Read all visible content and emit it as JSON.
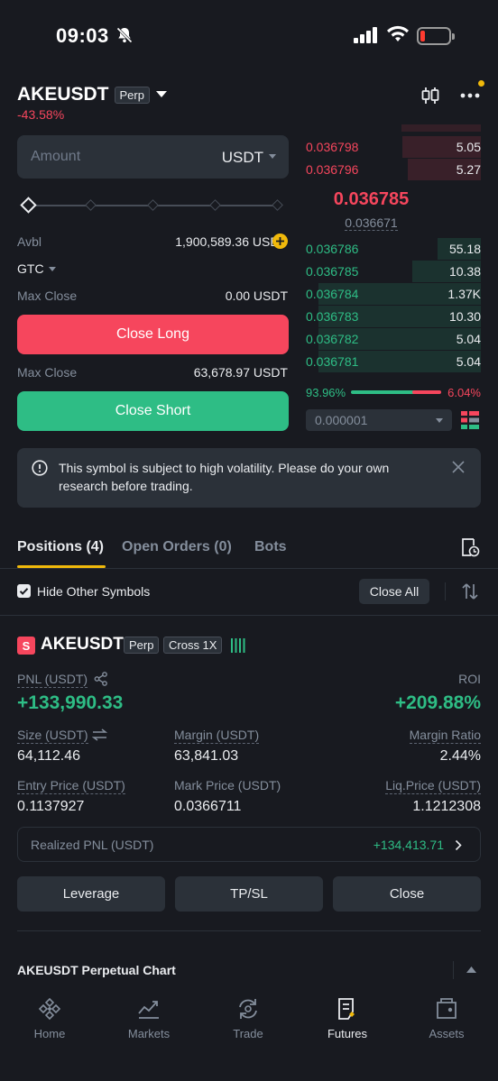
{
  "status_bar": {
    "time": "09:03"
  },
  "header": {
    "symbol": "AKEUSDT",
    "contract_type": "Perp",
    "change_pct": "-43.58%"
  },
  "order_form": {
    "amount_placeholder": "Amount",
    "amount_unit": "USDT",
    "avbl_label": "Avbl",
    "avbl_value": "1,900,589.36 USDT",
    "tif": "GTC",
    "max_close_label_1": "Max Close",
    "max_close_value_1": "0.00 USDT",
    "close_long_label": "Close Long",
    "max_close_label_2": "Max Close",
    "max_close_value_2": "63,678.97 USDT",
    "close_short_label": "Close Short"
  },
  "orderbook": {
    "asks": [
      {
        "price": "0.036798",
        "qty": "5.05",
        "depth": 0.45
      },
      {
        "price": "0.036796",
        "qty": "5.27",
        "depth": 0.42
      }
    ],
    "last_price": "0.036785",
    "mark_price": "0.036671",
    "bids": [
      {
        "price": "0.036786",
        "qty": "55.18",
        "depth": 0.25
      },
      {
        "price": "0.036785",
        "qty": "10.38",
        "depth": 0.39
      },
      {
        "price": "0.036784",
        "qty": "1.37K",
        "depth": 0.93
      },
      {
        "price": "0.036783",
        "qty": "10.30",
        "depth": 0.93
      },
      {
        "price": "0.036782",
        "qty": "5.04",
        "depth": 0.93
      },
      {
        "price": "0.036781",
        "qty": "5.04",
        "depth": 0.93
      }
    ],
    "buy_ratio": "93.96%",
    "sell_ratio": "6.04%",
    "buy_ratio_value": 0.9396,
    "precision": "0.000001"
  },
  "banner": {
    "text": "This symbol is subject to high volatility. Please do your own research before trading."
  },
  "tabs": {
    "positions": "Positions (4)",
    "open_orders": "Open Orders (0)",
    "bots": "Bots"
  },
  "filters": {
    "hide_other_symbols": "Hide Other Symbols",
    "close_all": "Close All"
  },
  "position": {
    "badge": "S",
    "symbol": "AKEUSDT",
    "type": "Perp",
    "margin_mode": "Cross 1X",
    "pnl_label": "PNL (USDT)",
    "pnl_value": "+133,990.33",
    "roi_label": "ROI",
    "roi_value": "+209.88%",
    "size_label": "Size (USDT)",
    "size_value": "64,112.46",
    "margin_label": "Margin (USDT)",
    "margin_value": "63,841.03",
    "margin_ratio_label": "Margin Ratio",
    "margin_ratio_value": "2.44%",
    "entry_label": "Entry Price (USDT)",
    "entry_value": "0.1137927",
    "mark_label": "Mark Price (USDT)",
    "mark_value": "0.0366711",
    "liq_label": "Liq.Price (USDT)",
    "liq_value": "1.1212308",
    "realized_label": "Realized PNL (USDT)",
    "realized_value": "+134,413.71",
    "leverage_btn": "Leverage",
    "tpsl_btn": "TP/SL",
    "close_btn": "Close"
  },
  "chart_section": {
    "title": "AKEUSDT Perpetual Chart"
  },
  "nav": [
    {
      "label": "Home",
      "icon": "home-icon"
    },
    {
      "label": "Markets",
      "icon": "markets-icon"
    },
    {
      "label": "Trade",
      "icon": "trade-icon"
    },
    {
      "label": "Futures",
      "icon": "futures-icon",
      "active": true
    },
    {
      "label": "Assets",
      "icon": "assets-icon"
    }
  ],
  "colors": {
    "background": "#181a20",
    "red": "#f6465d",
    "green": "#2ebd85",
    "accent": "#f0b90b"
  }
}
